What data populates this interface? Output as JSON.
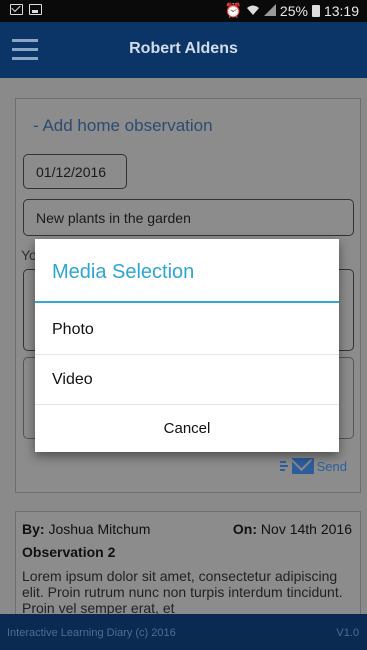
{
  "status_bar": {
    "battery": "25%",
    "time": "13:19"
  },
  "header": {
    "title": "Robert Aldens"
  },
  "form": {
    "add_label": "- Add home observation",
    "date_value": "01/12/2016",
    "title_value": "New plants in the garden",
    "partial_label": "Yo",
    "send_label": "Send"
  },
  "previous_observation": {
    "by_label": "By:",
    "by_value": "Joshua Mitchum",
    "on_label": "On:",
    "on_value": "Nov 14th 2016",
    "title": "Observation 2",
    "body": "Lorem ipsum dolor sit amet, consectetur adipiscing elit. Proin rutrum nunc non turpis interdum tincidunt. Proin vel semper erat, et"
  },
  "footer": {
    "copyright": "Interactive Learning Diary (c) 2016",
    "version": "V1.0"
  },
  "dialog": {
    "title": "Media Selection",
    "options": [
      "Photo",
      "Video"
    ],
    "cancel_label": "Cancel"
  },
  "colors": {
    "header_bg": "#0b3566",
    "dialog_accent": "#2ea6d3",
    "link": "#2c5f9e"
  },
  "icons": [
    "mail-notification-icon",
    "image-notification-icon",
    "alarm-icon",
    "wifi-icon",
    "signal-icon",
    "battery-icon",
    "hamburger-menu-icon",
    "send-mail-icon"
  ]
}
